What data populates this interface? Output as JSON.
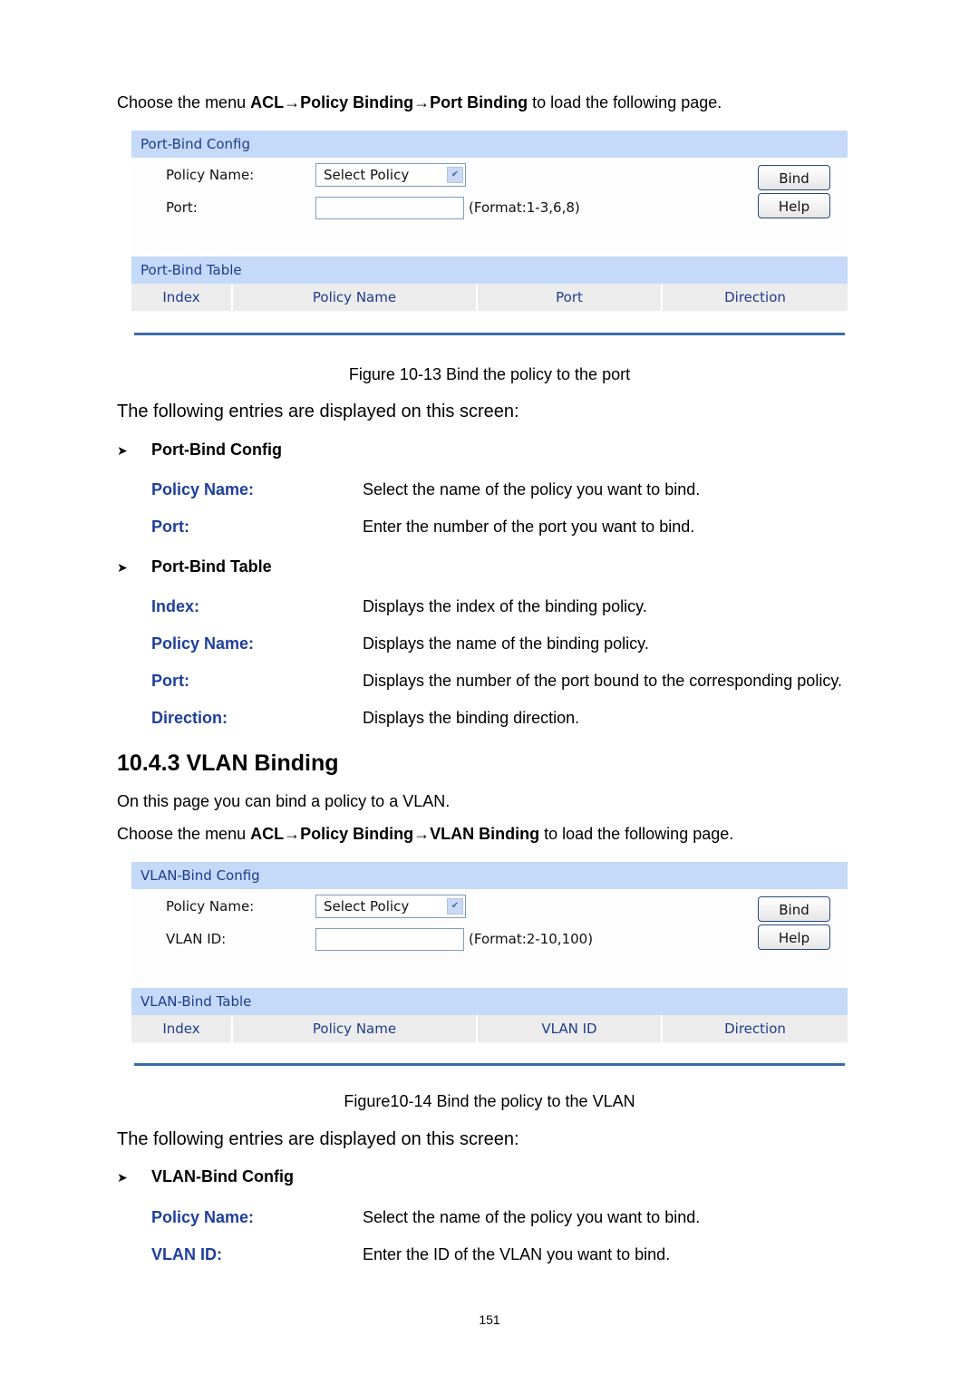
{
  "intro1": {
    "prefix": "Choose the menu ",
    "path1": "ACL",
    "arrow": "→",
    "path2": "Policy Binding",
    "path3": "Port Binding",
    "suffix": " to load the following page."
  },
  "port_panel": {
    "config_title": "Port-Bind Config",
    "policy_label": "Policy Name:",
    "policy_select_value": "Select Policy",
    "port_label": "Port:",
    "port_value": "",
    "port_hint": "(Format:1-3,6,8)",
    "bind_button": "Bind",
    "help_button": "Help",
    "table_title": "Port-Bind Table",
    "columns": [
      "Index",
      "Policy Name",
      "Port",
      "Direction"
    ]
  },
  "caption1": "Figure 10-13 Bind the policy to the port",
  "entries_intro1": "The following entries are displayed on this screen:",
  "port_config_section": {
    "title": "Port-Bind Config",
    "items": [
      {
        "term": "Policy Name:",
        "desc": "Select the name of the policy you want to bind."
      },
      {
        "term": "Port:",
        "desc": "Enter the number of the port you want to bind."
      }
    ]
  },
  "port_table_section": {
    "title": "Port-Bind Table",
    "items": [
      {
        "term": "Index:",
        "desc": "Displays the index of the binding policy."
      },
      {
        "term": "Policy Name:",
        "desc": "Displays the name of the binding policy."
      },
      {
        "term": "Port:",
        "desc": "Displays the number of the port bound to the corresponding policy."
      },
      {
        "term": "Direction:",
        "desc": "Displays the binding direction."
      }
    ]
  },
  "heading": "10.4.3  VLAN Binding",
  "vlan_intro": "On this page you can bind a policy to a VLAN.",
  "intro2": {
    "prefix": "Choose the menu ",
    "path1": "ACL",
    "arrow": "→",
    "path2": "Policy Binding",
    "path3": "VLAN Binding",
    "suffix": " to load the following page."
  },
  "vlan_panel": {
    "config_title": "VLAN-Bind Config",
    "policy_label": "Policy Name:",
    "policy_select_value": "Select Policy",
    "vlan_label": "VLAN ID:",
    "vlan_value": "",
    "vlan_hint": "(Format:2-10,100)",
    "bind_button": "Bind",
    "help_button": "Help",
    "table_title": "VLAN-Bind Table",
    "columns": [
      "Index",
      "Policy Name",
      "VLAN ID",
      "Direction"
    ]
  },
  "caption2": "Figure10-14 Bind the policy to the VLAN",
  "entries_intro2": "The following entries are displayed on this screen:",
  "vlan_config_section": {
    "title": "VLAN-Bind Config",
    "items": [
      {
        "term": "Policy Name:",
        "desc": "Select the name of the policy you want to bind."
      },
      {
        "term": "VLAN ID:",
        "desc": "Enter the ID of the VLAN you want to bind."
      }
    ]
  },
  "page_number": "151",
  "colors": {
    "term_blue": "#1e3f9a",
    "panel_header_bg": "#c5daf9",
    "panel_text_blue": "#1f3c8c",
    "table_line": "#3b6aa8"
  }
}
